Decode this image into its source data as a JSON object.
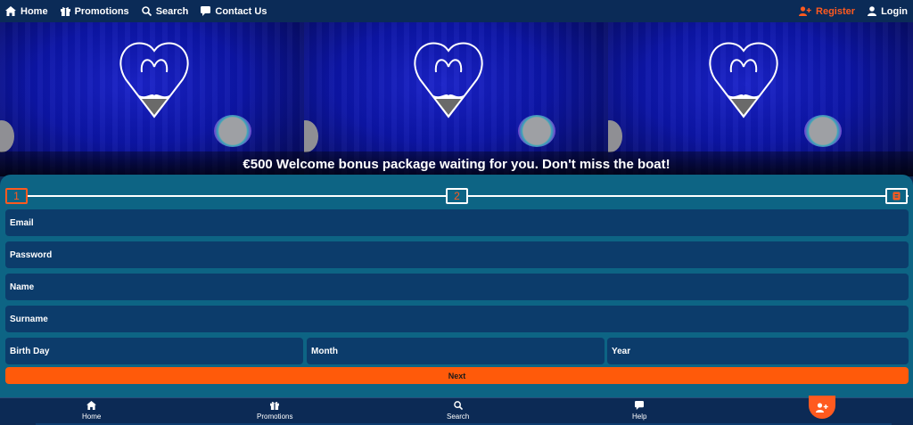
{
  "nav": {
    "home": "Home",
    "promotions": "Promotions",
    "search": "Search",
    "contact": "Contact Us",
    "register": "Register",
    "login": "Login"
  },
  "hero": {
    "caption": "€500 Welcome bonus package waiting for you. Don't miss the boat!"
  },
  "steps": [
    "1",
    "2"
  ],
  "form": {
    "email": "Email",
    "password": "Password",
    "name": "Name",
    "surname": "Surname",
    "birth_day": "Birth Day",
    "month": "Month",
    "year": "Year",
    "next": "Next"
  },
  "bottom_nav": {
    "home": "Home",
    "promotions": "Promotions",
    "search": "Search",
    "help": "Help"
  },
  "colors": {
    "accent": "#ff5a1f",
    "nav_bg": "#0b2b57",
    "form_bg": "#0d6484",
    "field_bg": "#0c3c6b"
  }
}
